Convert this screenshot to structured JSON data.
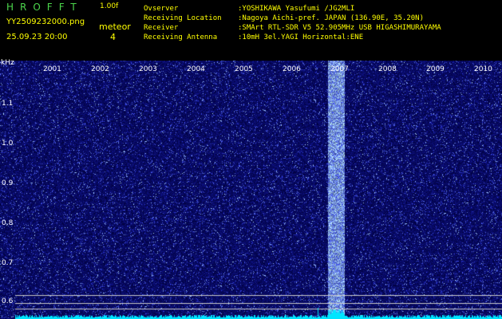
{
  "header": {
    "logo": "HROFFT",
    "version": "1.00f",
    "filename": "YY2509232000.png",
    "datetime": "25.09.23 20:00",
    "meteor_label": "meteor",
    "meteor_count": "4"
  },
  "info": [
    {
      "key": "Ovserver",
      "value": ":YOSHIKAWA Yasufumi /JG2MLI"
    },
    {
      "key": "Receiving Location",
      "value": ":Nagoya Aichi-pref. JAPAN (136.90E, 35.20N)"
    },
    {
      "key": "Receiver",
      "value": ":SMArt RTL-SDR V5 52.905MHz USB HIGASHIMURAYAMA"
    },
    {
      "key": "Receiving Antenna",
      "value": ":10mH 3el.YAGI Horizontal:ENE"
    }
  ],
  "axis": {
    "y_unit": "kHz",
    "y_ticks": [
      "1.1",
      "1.0",
      "0.9",
      "0.8",
      "0.7",
      "0.6"
    ],
    "x_ticks": [
      "2001",
      "2002",
      "2003",
      "2004",
      "2005",
      "2006",
      "2007",
      "2008",
      "2009",
      "2010"
    ]
  },
  "colors": {
    "background": "#000000",
    "noise_base": "#0a0a6e",
    "noise_bright": "#4a5aff",
    "signal": "#6fa0ff",
    "baseline": "#00e5ff",
    "gridline": "#c8c8c8",
    "header_green": "#4cd64c",
    "header_yellow": "#ffff00"
  }
}
